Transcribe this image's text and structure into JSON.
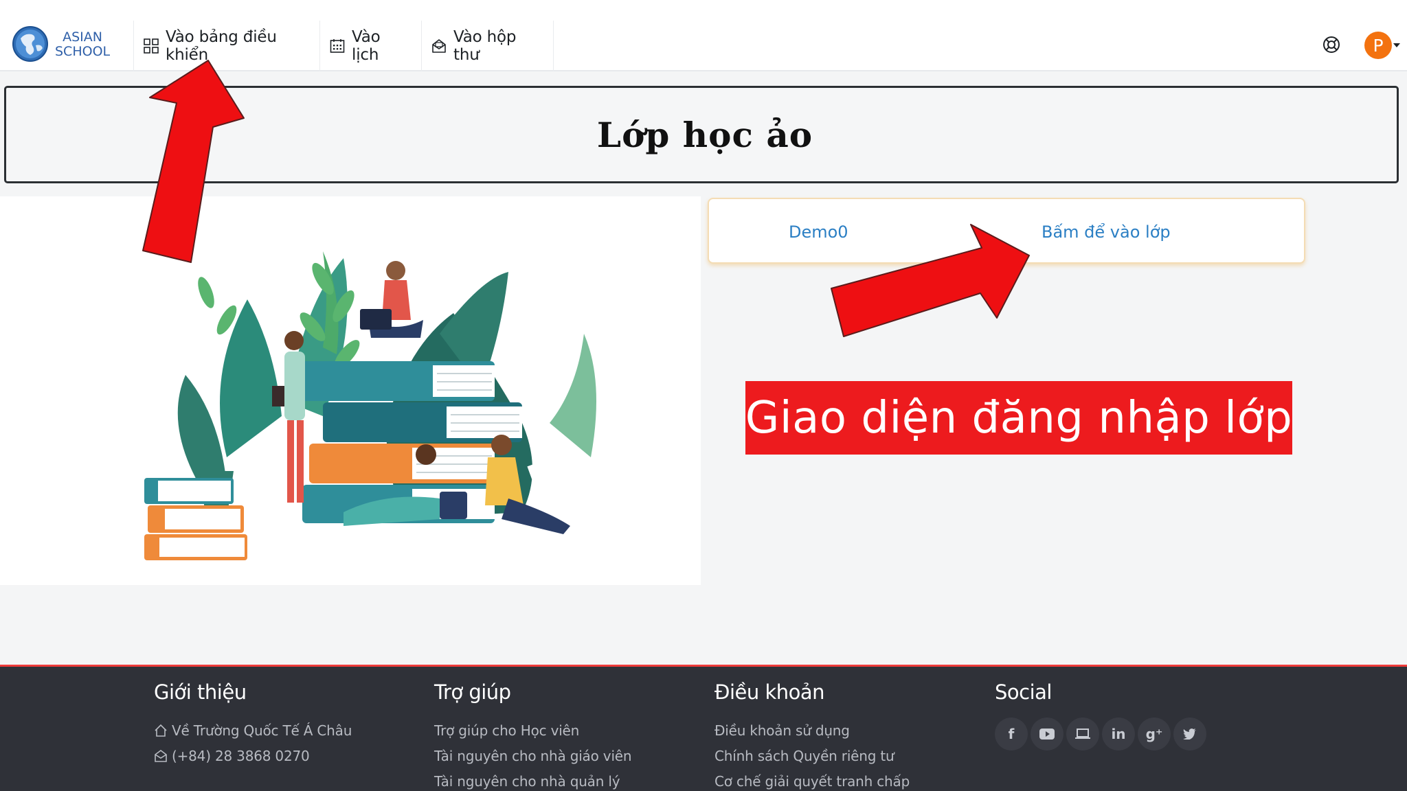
{
  "brand": {
    "line1": "ASIAN",
    "line2": "SCHOOL"
  },
  "nav": {
    "dashboard": "Vào bảng điều khiển",
    "calendar": "Vào lịch",
    "inbox": "Vào hộp thư"
  },
  "user": {
    "initial": "P"
  },
  "page_title": "Lớp học ảo",
  "class_card": {
    "name": "Demo0",
    "enter_link": "Bấm để vào lớp"
  },
  "overlay_label": "Giao diện đăng nhập lớp",
  "colors": {
    "accent": "#ed1b1e",
    "link": "#2b7fc4",
    "avatar": "#f3720f",
    "footer_bg": "#2f3138"
  },
  "footer": {
    "intro": {
      "heading": "Giới thiệu",
      "items": [
        "Về Trường Quốc Tế Á Châu",
        "(+84) 28 3868 0270"
      ]
    },
    "help": {
      "heading": "Trợ giúp",
      "items": [
        "Trợ giúp cho Học viên",
        "Tài nguyên cho nhà giáo viên",
        "Tài nguyên cho nhà quản lý"
      ]
    },
    "terms": {
      "heading": "Điều khoản",
      "items": [
        "Điều khoản sử dụng",
        "Chính sách Quyền riêng tư",
        "Cơ chế giải quyết tranh chấp"
      ]
    },
    "social": {
      "heading": "Social",
      "icons": [
        "facebook-icon",
        "youtube-icon",
        "laptop-icon",
        "linkedin-icon",
        "google-plus-icon",
        "twitter-icon"
      ]
    }
  }
}
